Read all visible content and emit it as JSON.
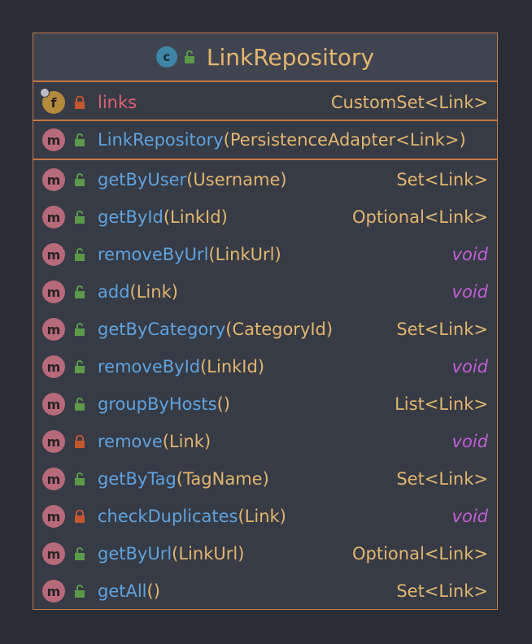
{
  "class_box": {
    "class_icon_letter": "c",
    "title": "LinkRepository"
  },
  "fields": [
    {
      "badge": "f",
      "visibility": "private",
      "name": "links",
      "type": "CustomSet<Link>"
    }
  ],
  "constructors": [
    {
      "badge": "m",
      "visibility": "public",
      "name": "LinkRepository",
      "params": "(PersistenceAdapter<Link>)",
      "ret": ""
    }
  ],
  "methods": [
    {
      "badge": "m",
      "visibility": "public",
      "name": "getByUser",
      "params": "(Username)",
      "ret": "Set<Link>"
    },
    {
      "badge": "m",
      "visibility": "public",
      "name": "getById",
      "params": "(LinkId)",
      "ret": "Optional<Link>"
    },
    {
      "badge": "m",
      "visibility": "public",
      "name": "removeByUrl",
      "params": "(LinkUrl)",
      "ret": "void"
    },
    {
      "badge": "m",
      "visibility": "public",
      "name": "add",
      "params": "(Link)",
      "ret": "void"
    },
    {
      "badge": "m",
      "visibility": "public",
      "name": "getByCategory",
      "params": "(CategoryId)",
      "ret": "Set<Link>"
    },
    {
      "badge": "m",
      "visibility": "public",
      "name": "removeById",
      "params": "(LinkId)",
      "ret": "void"
    },
    {
      "badge": "m",
      "visibility": "public",
      "name": "groupByHosts",
      "params": "()",
      "ret": "List<Link>"
    },
    {
      "badge": "m",
      "visibility": "private",
      "name": "remove",
      "params": "(Link)",
      "ret": "void"
    },
    {
      "badge": "m",
      "visibility": "public",
      "name": "getByTag",
      "params": "(TagName)",
      "ret": "Set<Link>"
    },
    {
      "badge": "m",
      "visibility": "private",
      "name": "checkDuplicates",
      "params": "(Link)",
      "ret": "void"
    },
    {
      "badge": "m",
      "visibility": "public",
      "name": "getByUrl",
      "params": "(LinkUrl)",
      "ret": "Optional<Link>"
    },
    {
      "badge": "m",
      "visibility": "public",
      "name": "getAll",
      "params": "()",
      "ret": "Set<Link>"
    }
  ],
  "colors": {
    "border": "#c07a45",
    "method_name": "#5ea3e0",
    "field_name": "#e05f73",
    "type": "#e3b66f",
    "void": "#c35fd9",
    "public_lock": "#5b9a4a",
    "private_lock": "#c2562f"
  }
}
